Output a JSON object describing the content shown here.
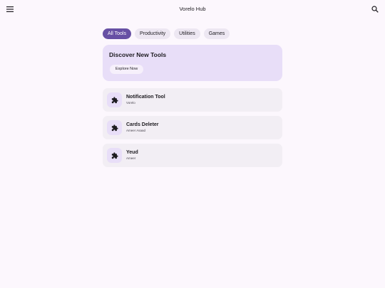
{
  "header": {
    "title": "Vorelo Hub",
    "menu_icon": "menu-icon",
    "search_icon": "search-icon"
  },
  "filters": [
    {
      "label": "All Tools",
      "selected": true
    },
    {
      "label": "Productivity",
      "selected": false
    },
    {
      "label": "Utilities",
      "selected": false
    },
    {
      "label": "Games",
      "selected": false
    }
  ],
  "hero": {
    "title": "Discover New Tools",
    "button_label": "Explore Now"
  },
  "tools": [
    {
      "name": "Notification Tool",
      "author": "Vorelo",
      "icon": "puzzle-icon"
    },
    {
      "name": "Cards Deleter",
      "author": "Ameer Asaad",
      "icon": "puzzle-icon"
    },
    {
      "name": "Yeud",
      "author": "Ameer",
      "icon": "puzzle-icon"
    }
  ],
  "colors": {
    "background": "#fcf7fd",
    "accent": "#6750a4",
    "hero": "#e8def8",
    "card": "#f2eef4"
  }
}
